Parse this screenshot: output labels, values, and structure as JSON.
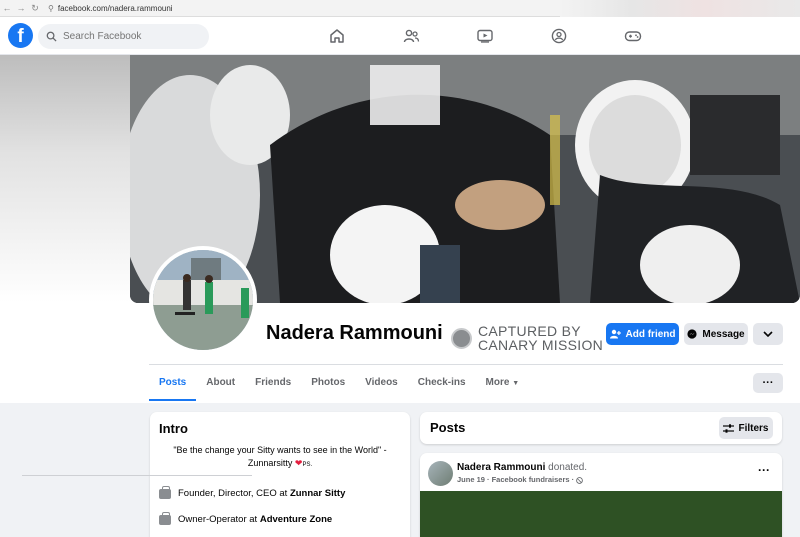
{
  "browser": {
    "url": "facebook.com/nadera.rammouni"
  },
  "topnav": {
    "logo": "f",
    "search_placeholder": "Search Facebook",
    "icons": [
      "home-icon",
      "friends-icon",
      "video-icon",
      "groups-icon",
      "gaming-icon"
    ]
  },
  "profile": {
    "name": "Nadera Rammouni",
    "watermark_line1": "CAPTURED BY",
    "watermark_line2": "CANARY MISSION",
    "add_friend_label": "Add friend",
    "message_label": "Message"
  },
  "tabs": [
    {
      "label": "Posts",
      "active": true
    },
    {
      "label": "About"
    },
    {
      "label": "Friends"
    },
    {
      "label": "Photos"
    },
    {
      "label": "Videos"
    },
    {
      "label": "Check-ins"
    },
    {
      "label": "More"
    }
  ],
  "intro": {
    "title": "Intro",
    "bio": "\"Be the change your Sitty wants to see in the World\" - Zunnarsitty",
    "bio_suffix": "PS.",
    "work": [
      {
        "prefix": "Founder, Director, CEO at",
        "org": "Zunnar Sitty"
      },
      {
        "prefix": "Owner-Operator at",
        "org": "Adventure Zone"
      }
    ]
  },
  "posts": {
    "title": "Posts",
    "filters_label": "Filters",
    "items": [
      {
        "author": "Nadera Rammouni",
        "action": "donated.",
        "meta": "June 19 · Facebook fundraisers ·"
      }
    ]
  },
  "colors": {
    "brand": "#1877f2",
    "heart": "#e41e3f"
  }
}
